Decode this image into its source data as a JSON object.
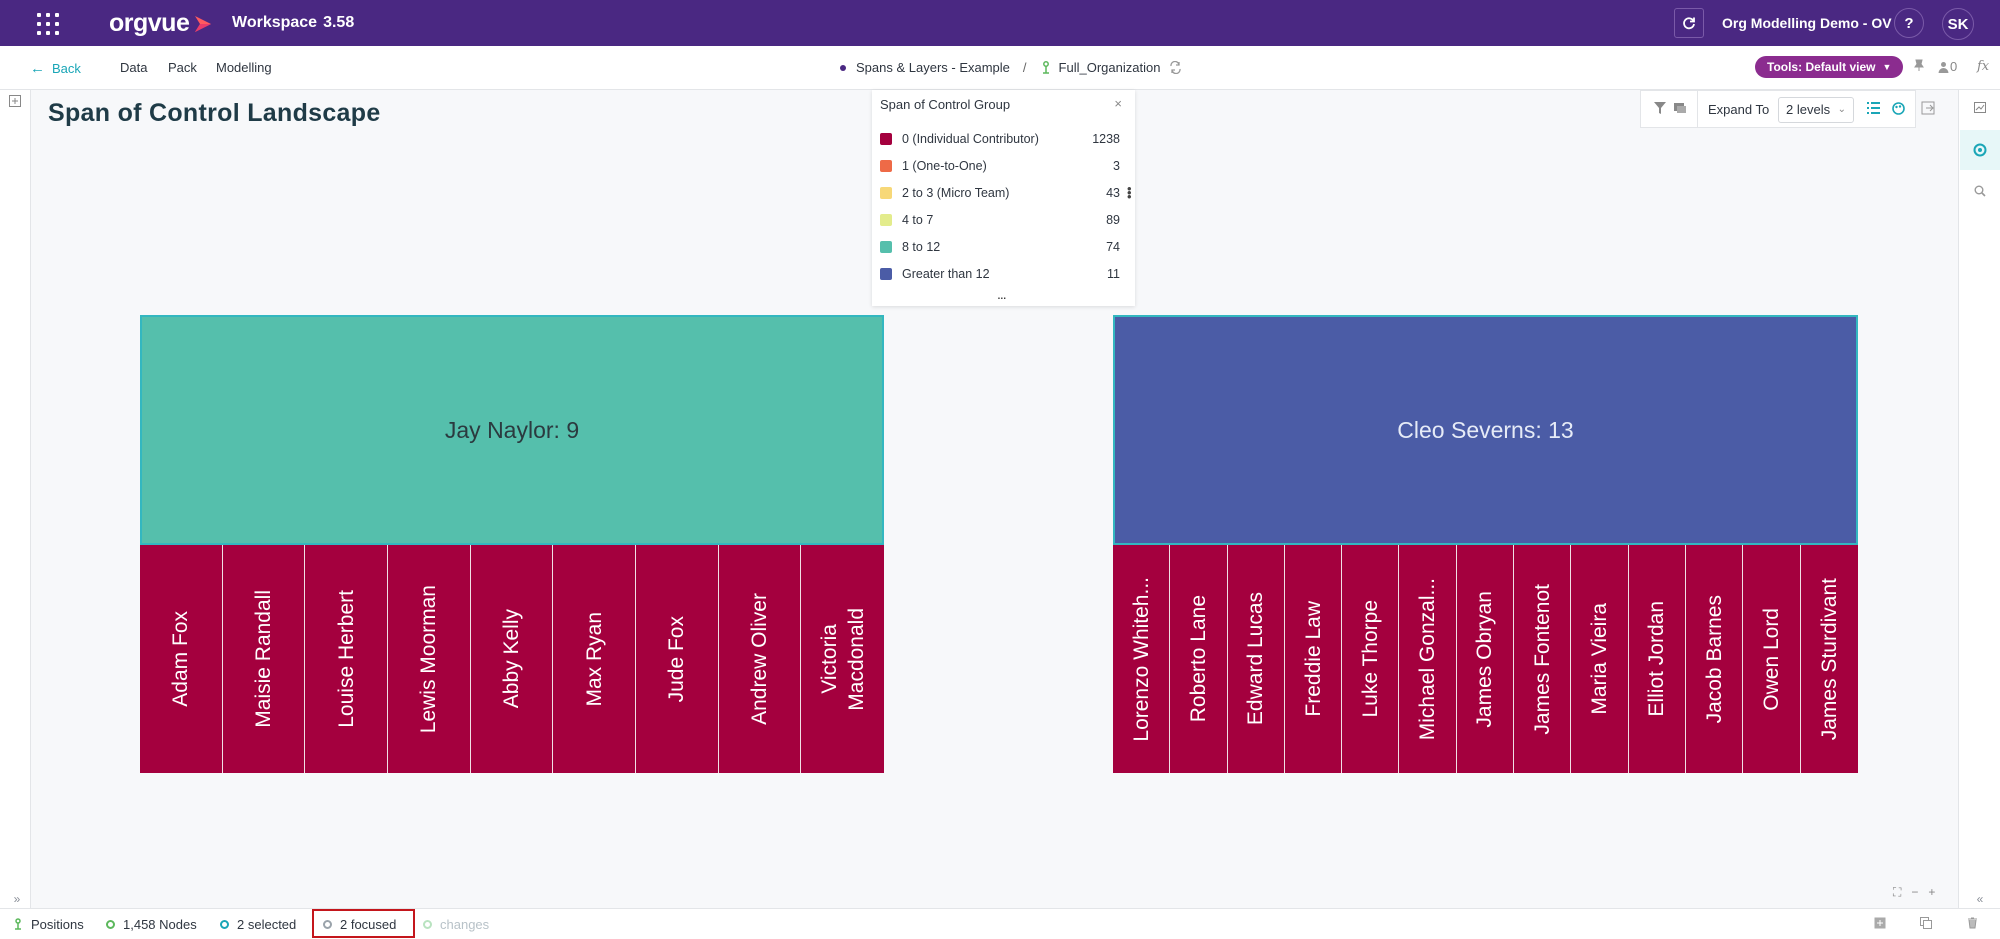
{
  "topbar": {
    "brand": "orgvue",
    "workspace_label": "Workspace",
    "workspace_version": "3.58",
    "org_name": "Org Modelling Demo - OV",
    "help_label": "?",
    "avatar_initials": "SK",
    "bg_color": "#4a2882"
  },
  "nav": {
    "back_label": "Back",
    "items": [
      "Data",
      "Pack",
      "Modelling"
    ],
    "breadcrumb_dataset": "Spans & Layers - Example",
    "breadcrumb_separator": "/",
    "breadcrumb_hierarchy": "Full_Organization",
    "tools_label": "Tools: Default view",
    "count_label": "0",
    "fx_label": "fx"
  },
  "main": {
    "title": "Span of Control Landscape",
    "expand_label": "Expand To",
    "expand_value": "2 levels"
  },
  "legend": {
    "title": "Span of Control Group",
    "close_label": "×",
    "more_label": "...",
    "items": [
      {
        "label": "0 (Individual Contributor)",
        "count": "1238",
        "color": "#a4003e"
      },
      {
        "label": "1 (One-to-One)",
        "count": "3",
        "color": "#ee6a47"
      },
      {
        "label": "2 to 3 (Micro Team)",
        "count": "43",
        "color": "#f7d878"
      },
      {
        "label": "4 to 7",
        "count": "89",
        "color": "#e3ec8c"
      },
      {
        "label": "8 to 12",
        "count": "74",
        "color": "#55bfac"
      },
      {
        "label": "Greater than 12",
        "count": "11",
        "color": "#4b5ca6"
      }
    ]
  },
  "managers": [
    {
      "label": "Jay Naylor: 9",
      "color": "#55bfac",
      "text_color": "#2b3a3f",
      "reports": [
        "Adam Fox",
        "Maisie Randall",
        "Louise Herbert",
        "Lewis Moorman",
        "Abby Kelly",
        "Max Ryan",
        "Jude Fox",
        "Andrew Oliver",
        "Victoria\nMacdonald"
      ]
    },
    {
      "label": "Cleo Severns: 13",
      "color": "#4b5ca6",
      "text_color": "#e6ebf7",
      "reports": [
        "Lorenzo Whiteh...",
        "Roberto Lane",
        "Edward Lucas",
        "Freddie Law",
        "Luke Thorpe",
        "Michael Gonzal...",
        "James Obryan",
        "James Fontenot",
        "Maria Vieira",
        "Elliot Jordan",
        "Jacob Barnes",
        "Owen Lord",
        "James Sturdivant"
      ]
    }
  ],
  "status": {
    "positions_label": "Positions",
    "nodes_label": "1,458 Nodes",
    "selected_label": "2 selected",
    "focused_label": "2 focused",
    "changes_label": "changes"
  }
}
